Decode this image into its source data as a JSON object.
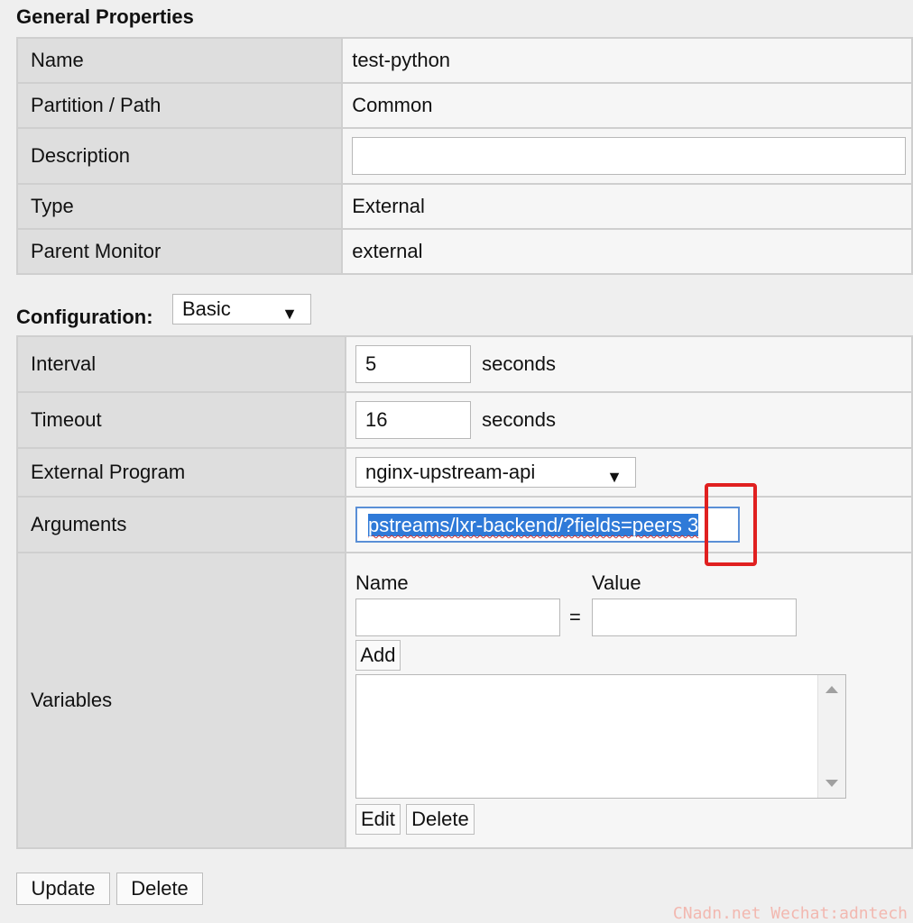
{
  "general": {
    "title": "General Properties",
    "rows": [
      {
        "label": "Name",
        "value": "test-python"
      },
      {
        "label": "Partition / Path",
        "value": "Common"
      },
      {
        "label": "Description",
        "value": ""
      },
      {
        "label": "Type",
        "value": "External"
      },
      {
        "label": "Parent Monitor",
        "value": "external"
      }
    ]
  },
  "configuration": {
    "title": "Configuration:",
    "mode": "Basic",
    "interval": {
      "label": "Interval",
      "value": "5",
      "unit": "seconds"
    },
    "timeout": {
      "label": "Timeout",
      "value": "16",
      "unit": "seconds"
    },
    "external_program": {
      "label": "External Program",
      "value": "nginx-upstream-api"
    },
    "arguments": {
      "label": "Arguments",
      "value": "pstreams/lxr-backend/?fields=peers 3"
    },
    "variables": {
      "label": "Variables",
      "name_header": "Name",
      "value_header": "Value",
      "equals": "=",
      "add_label": "Add",
      "edit_label": "Edit",
      "delete_label": "Delete"
    }
  },
  "footer": {
    "update_label": "Update",
    "delete_label": "Delete"
  },
  "watermark": "CNadn.net Wechat:adntech",
  "colors": {
    "highlight_box": "#e02020",
    "selection": "#2f7ad8"
  },
  "icons": {
    "dropdown": "triangle-down",
    "scroll_up": "triangle-up",
    "scroll_down": "triangle-down"
  }
}
